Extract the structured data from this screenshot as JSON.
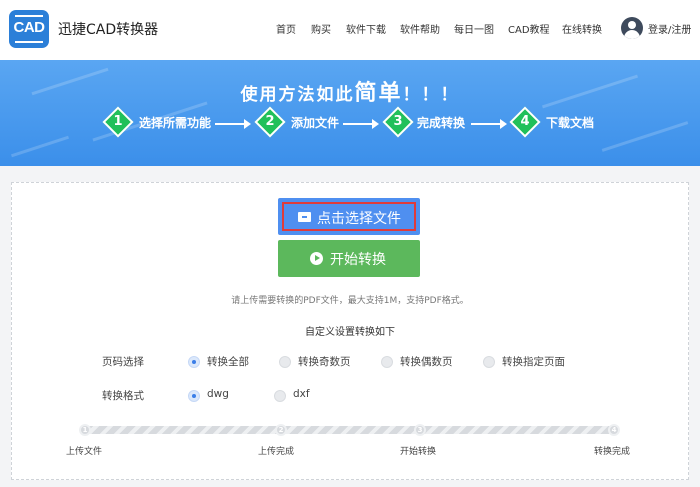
{
  "header": {
    "logo_text": "CAD",
    "brand": "迅捷CAD转换器",
    "nav": [
      "首页",
      "购买",
      "软件下载",
      "软件帮助",
      "每日一图",
      "CAD教程",
      "在线转换"
    ],
    "login": "登录/注册"
  },
  "banner": {
    "slogan_prefix": "使用方法如此",
    "slogan_big": "简单",
    "slogan_suffix": "！！！",
    "steps": [
      {
        "num": "1",
        "label": "选择所需功能"
      },
      {
        "num": "2",
        "label": "添加文件"
      },
      {
        "num": "3",
        "label": "完成转换"
      },
      {
        "num": "4",
        "label": "下载文档"
      }
    ]
  },
  "main": {
    "select_button": "点击选择文件",
    "start_button": "开始转换",
    "hint": "请上传需要转换的PDF文件，最大支持1M，支持PDF格式。",
    "custom_title": "自定义设置转换如下",
    "page_row": {
      "label": "页码选择",
      "options": [
        "转换全部",
        "转换奇数页",
        "转换偶数页",
        "转换指定页面"
      ],
      "selected": "转换全部"
    },
    "format_row": {
      "label": "转换格式",
      "options": [
        "dwg",
        "dxf"
      ],
      "selected": "dwg"
    },
    "progress": {
      "steps": [
        "上传文件",
        "上传完成",
        "开始转换",
        "转换完成"
      ],
      "step_numbers": [
        "1",
        "2",
        "3",
        "4"
      ],
      "current": 0
    }
  },
  "colors": {
    "banner": "#3b8fea",
    "select_button": "#4f8ff0",
    "start_button": "#5cb85c",
    "step_diamond": "#21c05a",
    "highlight_border": "#e03b3b"
  }
}
